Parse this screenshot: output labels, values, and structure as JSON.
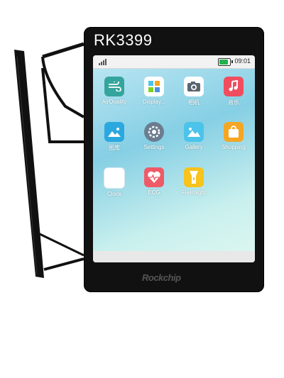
{
  "device": {
    "title": "RK3399",
    "brand": "Rockchip"
  },
  "statusbar": {
    "time": "09:01",
    "battery_level": 1.0
  },
  "apps": [
    {
      "name": "air-quality-app",
      "label": "AirQuality",
      "icon": "wind-icon",
      "color": "#3aa8a0"
    },
    {
      "name": "display-app",
      "label": "Display...",
      "icon": "display-icon",
      "color": "#ffffff"
    },
    {
      "name": "camera-app",
      "label": "相机",
      "icon": "camera-icon",
      "color": "#ffffff"
    },
    {
      "name": "music-app",
      "label": "音乐",
      "icon": "music-icon",
      "color": "#f04d5f"
    },
    {
      "name": "gallery-cn-app",
      "label": "图库",
      "icon": "image-icon",
      "color": "#2ba8e0"
    },
    {
      "name": "settings-app",
      "label": "Settings",
      "icon": "settings-icon",
      "color": "#6a7d8f"
    },
    {
      "name": "gallery-app",
      "label": "Gallery",
      "icon": "landscape-icon",
      "color": "#4cc3ea"
    },
    {
      "name": "shopping-app",
      "label": "Shopping",
      "icon": "shopping-bag-icon",
      "color": "#f5a623"
    },
    {
      "name": "clock-app",
      "label": "Clock",
      "icon": "clock-icon",
      "color": "#ffffff"
    },
    {
      "name": "ecg-app",
      "label": "ECG",
      "icon": "heart-icon",
      "color": "#ef5a67"
    },
    {
      "name": "flashlight-app",
      "label": "Flashlight",
      "icon": "flashlight-icon",
      "color": "#f7c31c"
    }
  ]
}
